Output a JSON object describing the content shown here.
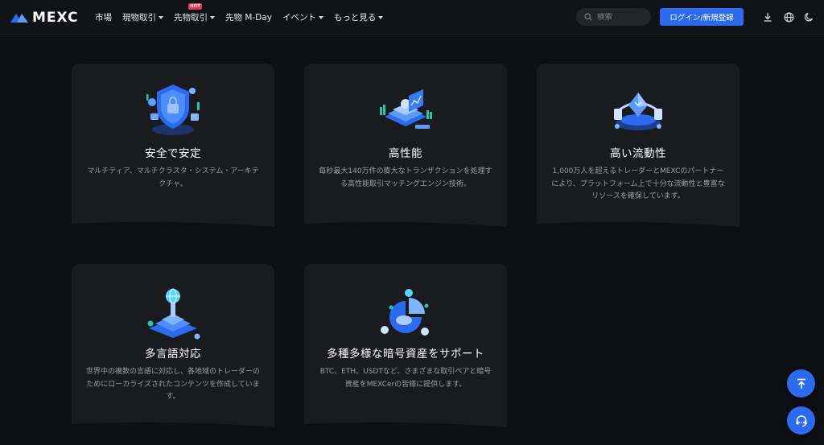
{
  "nav": {
    "logo_text": "MEXC",
    "items": [
      {
        "label": "市場",
        "has_caret": false
      },
      {
        "label": "現物取引",
        "has_caret": true
      },
      {
        "label": "先物取引",
        "has_caret": true,
        "badge": "HOT"
      },
      {
        "label": "先物 M-Day",
        "has_caret": false
      },
      {
        "label": "イベント",
        "has_caret": true
      },
      {
        "label": "もっと見る",
        "has_caret": true
      }
    ],
    "search_placeholder": "検索",
    "login_label": "ログイン/新規登録",
    "icons": [
      "download-icon",
      "globe-icon",
      "moon-icon"
    ]
  },
  "features": [
    {
      "title": "安全で安定",
      "desc": "マルチティア、マルチクラスタ・システム・アーキテクチャ。",
      "icon": "shield-icon"
    },
    {
      "title": "高性能",
      "desc": "毎秒最大140万件の膨大なトランザクションを処理する高性能取引マッチングエンジン技術。",
      "icon": "server-chart-icon"
    },
    {
      "title": "高い流動性",
      "desc": "1,000万人を超えるトレーダーとMEXCのパートナーにより、プラットフォーム上で十分な流動性と豊富なリソースを確保しています。",
      "icon": "crystal-platform-icon"
    },
    {
      "title": "多言語対応",
      "desc": "世界中の複数の言語に対応し、各地域のトレーダーのためにローカライズされたコンテンツを作成しています。",
      "icon": "globe-tower-icon"
    },
    {
      "title": "多種多様な暗号資産をサポート",
      "desc": "BTC、ETH、USDTなど、さまざまな取引ペアと暗号資産をMEXCerの皆様に提供します。",
      "icon": "coins-chart-icon"
    }
  ],
  "floating": {
    "scroll_top_icon": "arrow-up-icon",
    "support_icon": "headset-icon"
  },
  "colors": {
    "background": "#0e0f12",
    "card": "#1a1b1f",
    "accent": "#2c6bf0",
    "hot": "#e0374a"
  }
}
